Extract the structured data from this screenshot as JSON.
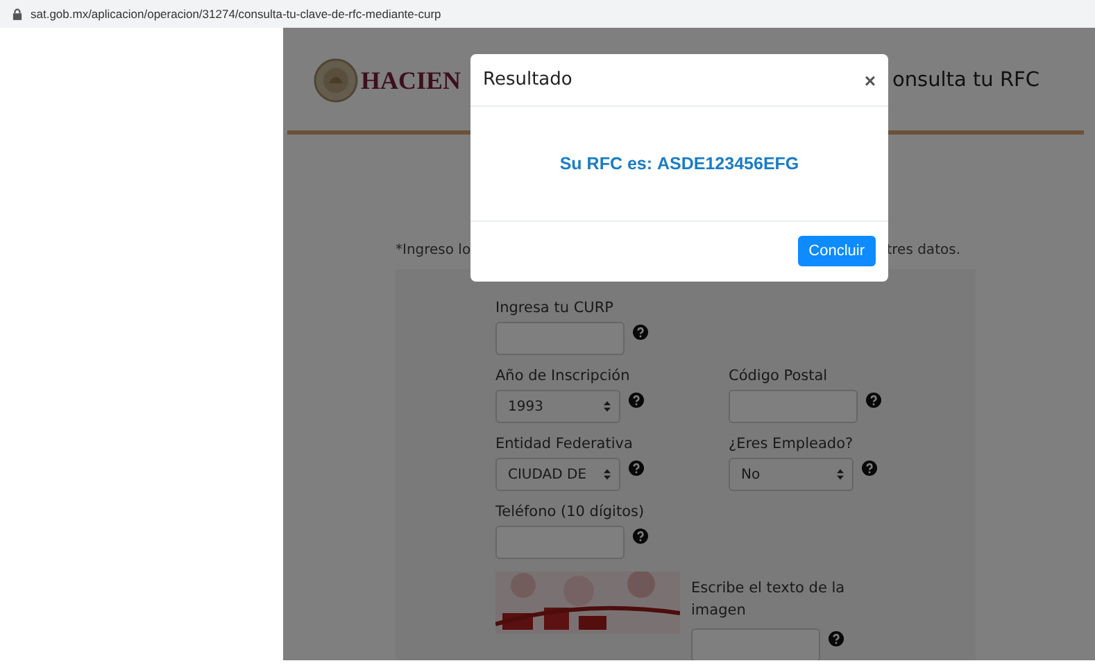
{
  "browser": {
    "url": "sat.gob.mx/aplicacion/operacion/31274/consulta-tu-clave-de-rfc-mediante-curp"
  },
  "page": {
    "header": {
      "logo_text": "HACIEN",
      "title": "onsulta tu RFC"
    },
    "instructions": [
      "*Ingreso lo",
      "tres datos."
    ],
    "form": {
      "rows": [
        [
          {
            "label": "Ingresa tu CURP",
            "kind": "input"
          }
        ],
        [
          {
            "label": "Año de Inscripción",
            "kind": "select",
            "value": "1993"
          },
          {
            "label": "Código Postal",
            "kind": "input"
          }
        ],
        [
          {
            "label": "Entidad Federativa",
            "kind": "select",
            "value": "CIUDAD DE"
          },
          {
            "label": "¿Eres Empleado?",
            "kind": "select",
            "value": "No"
          }
        ],
        [
          {
            "label": "Teléfono (10 dígitos)",
            "kind": "input"
          }
        ]
      ],
      "captcha": {
        "label": "Escribe el texto de la imagen"
      }
    }
  },
  "modal": {
    "title": "Resultado",
    "close": "×",
    "message": "Su RFC es: **ASDE123456EFG**",
    "buttons": [
      "Concluir"
    ]
  }
}
